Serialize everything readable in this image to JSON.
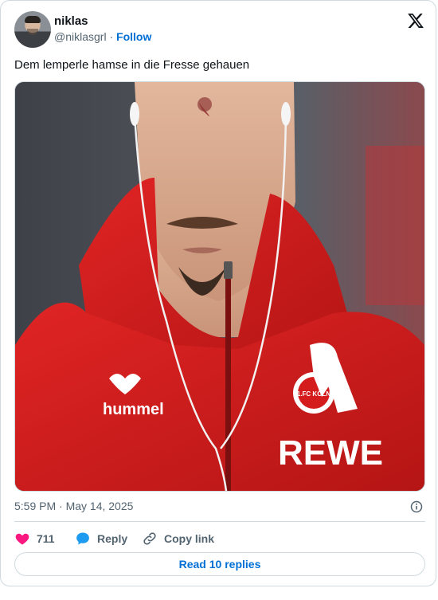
{
  "user": {
    "name": "niklas",
    "handle": "@niklasgrl",
    "separator": "·",
    "follow_label": "Follow"
  },
  "tweet": {
    "text": "Dem lemperle hamse in die Fresse gehauen"
  },
  "media": {
    "jacket_color": "#d41c1c",
    "sponsor_text": "REWE",
    "brand_text": "hummel",
    "crest_text": "1.FC KÖLN"
  },
  "meta": {
    "timestamp": "5:59 PM · May 14, 2025"
  },
  "actions": {
    "like_count": "711",
    "reply_label": "Reply",
    "copy_label": "Copy link"
  },
  "read_replies_label": "Read 10 replies",
  "colors": {
    "like": "#f91880",
    "reply": "#1d9bf0",
    "link": "#006fd6"
  }
}
